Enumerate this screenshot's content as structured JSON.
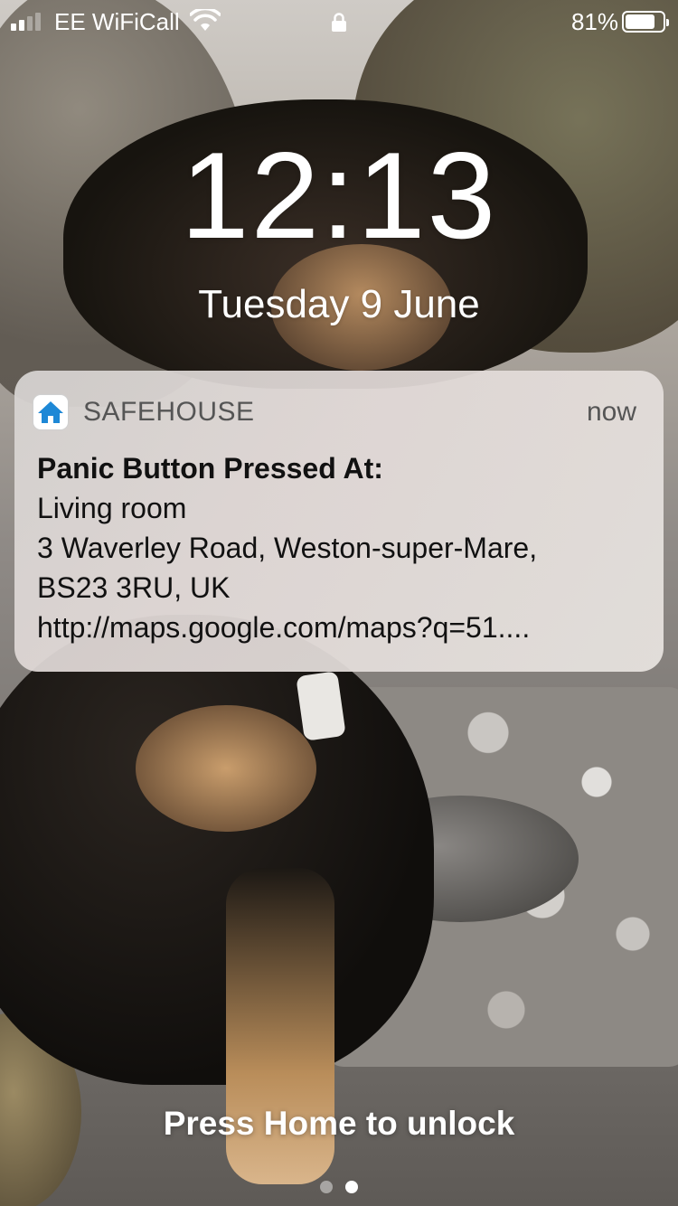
{
  "status_bar": {
    "carrier": "EE WiFiCall",
    "battery_percent": "81%",
    "battery_level": 0.81,
    "signal_bars": 2,
    "signal_bars_total": 4
  },
  "lock_screen": {
    "time": "12:13",
    "date": "Tuesday 9 June",
    "unlock_hint": "Press Home to unlock",
    "page_count": 2,
    "active_page": 2
  },
  "notification": {
    "app_name": "SAFEHOUSE",
    "app_icon": "house-icon",
    "app_icon_color": "#1e88d6",
    "time": "now",
    "title": "Panic Button Pressed At:",
    "lines": [
      "Living room",
      "3 Waverley Road, Weston-super-Mare,",
      "BS23 3RU, UK",
      "http://maps.google.com/maps?q=51...."
    ]
  }
}
